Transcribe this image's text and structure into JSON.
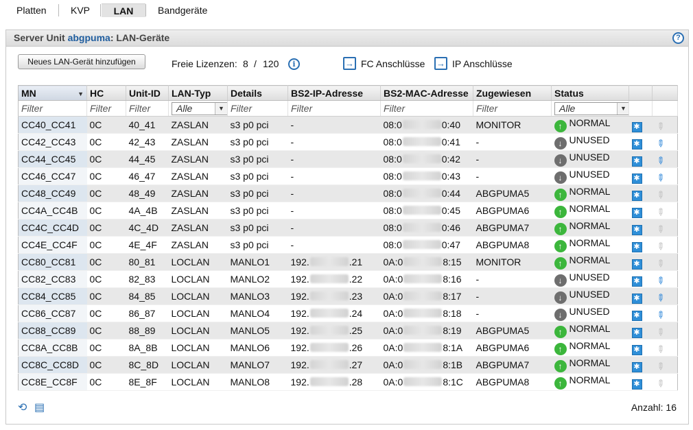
{
  "tabs": [
    {
      "label": "Platten"
    },
    {
      "label": "KVP"
    },
    {
      "label": "LAN",
      "active": true
    },
    {
      "label": "Bandgeräte"
    }
  ],
  "panel": {
    "title_prefix": "Server Unit",
    "title_link": "abgpuma",
    "title_suffix": ": LAN-Geräte"
  },
  "toolbar": {
    "add_button": "Neues LAN-Gerät hinzufügen",
    "license_label": "Freie Lizenzen:",
    "license_free": "8",
    "license_slash": "/",
    "license_total": "120",
    "fc_link": "FC Anschlüsse",
    "ip_link": "IP Anschlüsse"
  },
  "columns": [
    "MN",
    "HC",
    "Unit-ID",
    "LAN-Typ",
    "Details",
    "BS2-IP-Adresse",
    "BS2-MAC-Adresse",
    "Zugewiesen",
    "Status"
  ],
  "filters": {
    "text": "Filter",
    "select": "Alle"
  },
  "rows": [
    {
      "mn": "CC40_CC41",
      "hc": "0C",
      "unit": "40_41",
      "type": "ZASLAN",
      "details": "s3 p0 pci",
      "ip_a": "-",
      "ip_b": "",
      "mac_a": "08:0",
      "mac_b": "0:40",
      "assigned": "MONITOR",
      "status": "NORMAL",
      "edit": false
    },
    {
      "mn": "CC42_CC43",
      "hc": "0C",
      "unit": "42_43",
      "type": "ZASLAN",
      "details": "s3 p0 pci",
      "ip_a": "-",
      "ip_b": "",
      "mac_a": "08:0",
      "mac_b": "0:41",
      "assigned": "-",
      "status": "UNUSED",
      "edit": true
    },
    {
      "mn": "CC44_CC45",
      "hc": "0C",
      "unit": "44_45",
      "type": "ZASLAN",
      "details": "s3 p0 pci",
      "ip_a": "-",
      "ip_b": "",
      "mac_a": "08:0",
      "mac_b": "0:42",
      "assigned": "-",
      "status": "UNUSED",
      "edit": true
    },
    {
      "mn": "CC46_CC47",
      "hc": "0C",
      "unit": "46_47",
      "type": "ZASLAN",
      "details": "s3 p0 pci",
      "ip_a": "-",
      "ip_b": "",
      "mac_a": "08:0",
      "mac_b": "0:43",
      "assigned": "-",
      "status": "UNUSED",
      "edit": true
    },
    {
      "mn": "CC48_CC49",
      "hc": "0C",
      "unit": "48_49",
      "type": "ZASLAN",
      "details": "s3 p0 pci",
      "ip_a": "-",
      "ip_b": "",
      "mac_a": "08:0",
      "mac_b": "0:44",
      "assigned": "ABGPUMA5",
      "status": "NORMAL",
      "edit": false
    },
    {
      "mn": "CC4A_CC4B",
      "hc": "0C",
      "unit": "4A_4B",
      "type": "ZASLAN",
      "details": "s3 p0 pci",
      "ip_a": "-",
      "ip_b": "",
      "mac_a": "08:0",
      "mac_b": "0:45",
      "assigned": "ABGPUMA6",
      "status": "NORMAL",
      "edit": false
    },
    {
      "mn": "CC4C_CC4D",
      "hc": "0C",
      "unit": "4C_4D",
      "type": "ZASLAN",
      "details": "s3 p0 pci",
      "ip_a": "-",
      "ip_b": "",
      "mac_a": "08:0",
      "mac_b": "0:46",
      "assigned": "ABGPUMA7",
      "status": "NORMAL",
      "edit": false
    },
    {
      "mn": "CC4E_CC4F",
      "hc": "0C",
      "unit": "4E_4F",
      "type": "ZASLAN",
      "details": "s3 p0 pci",
      "ip_a": "-",
      "ip_b": "",
      "mac_a": "08:0",
      "mac_b": "0:47",
      "assigned": "ABGPUMA8",
      "status": "NORMAL",
      "edit": false
    },
    {
      "mn": "CC80_CC81",
      "hc": "0C",
      "unit": "80_81",
      "type": "LOCLAN",
      "details": "MANLO1",
      "ip_a": "192.",
      "ip_b": ".21",
      "mac_a": "0A:0",
      "mac_b": "8:15",
      "assigned": "MONITOR",
      "status": "NORMAL",
      "edit": false
    },
    {
      "mn": "CC82_CC83",
      "hc": "0C",
      "unit": "82_83",
      "type": "LOCLAN",
      "details": "MANLO2",
      "ip_a": "192.",
      "ip_b": ".22",
      "mac_a": "0A:0",
      "mac_b": "8:16",
      "assigned": "-",
      "status": "UNUSED",
      "edit": true
    },
    {
      "mn": "CC84_CC85",
      "hc": "0C",
      "unit": "84_85",
      "type": "LOCLAN",
      "details": "MANLO3",
      "ip_a": "192.",
      "ip_b": ".23",
      "mac_a": "0A:0",
      "mac_b": "8:17",
      "assigned": "-",
      "status": "UNUSED",
      "edit": true
    },
    {
      "mn": "CC86_CC87",
      "hc": "0C",
      "unit": "86_87",
      "type": "LOCLAN",
      "details": "MANLO4",
      "ip_a": "192.",
      "ip_b": ".24",
      "mac_a": "0A:0",
      "mac_b": "8:18",
      "assigned": "-",
      "status": "UNUSED",
      "edit": true
    },
    {
      "mn": "CC88_CC89",
      "hc": "0C",
      "unit": "88_89",
      "type": "LOCLAN",
      "details": "MANLO5",
      "ip_a": "192.",
      "ip_b": ".25",
      "mac_a": "0A:0",
      "mac_b": "8:19",
      "assigned": "ABGPUMA5",
      "status": "NORMAL",
      "edit": false
    },
    {
      "mn": "CC8A_CC8B",
      "hc": "0C",
      "unit": "8A_8B",
      "type": "LOCLAN",
      "details": "MANLO6",
      "ip_a": "192.",
      "ip_b": ".26",
      "mac_a": "0A:0",
      "mac_b": "8:1A",
      "assigned": "ABGPUMA6",
      "status": "NORMAL",
      "edit": false
    },
    {
      "mn": "CC8C_CC8D",
      "hc": "0C",
      "unit": "8C_8D",
      "type": "LOCLAN",
      "details": "MANLO7",
      "ip_a": "192.",
      "ip_b": ".27",
      "mac_a": "0A:0",
      "mac_b": "8:1B",
      "assigned": "ABGPUMA7",
      "status": "NORMAL",
      "edit": false
    },
    {
      "mn": "CC8E_CC8F",
      "hc": "0C",
      "unit": "8E_8F",
      "type": "LOCLAN",
      "details": "MANLO8",
      "ip_a": "192.",
      "ip_b": ".28",
      "mac_a": "0A:0",
      "mac_b": "8:1C",
      "assigned": "ABGPUMA8",
      "status": "NORMAL",
      "edit": false
    }
  ],
  "footer": {
    "count_label": "Anzahl: 16"
  },
  "colors": {
    "accent": "#1f5d9e",
    "status_normal": "#3cb63c",
    "status_unused": "#6e6e6e"
  }
}
